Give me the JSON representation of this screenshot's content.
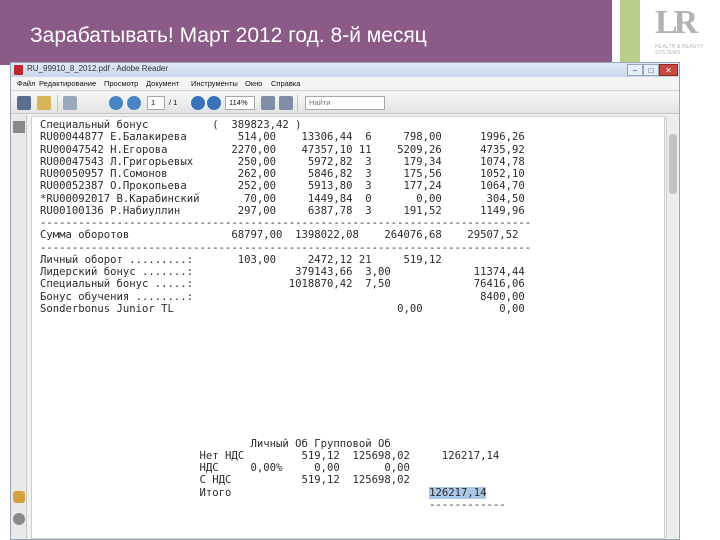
{
  "slide": {
    "title": "Зарабатывать! Март 2012 год.  8-й месяц"
  },
  "logo": {
    "mark": "LR",
    "tagline": "HEALTH & BEAUTY SYSTEMS"
  },
  "window": {
    "title": "RU_99910_8_2012.pdf - Adobe Reader",
    "min": "–",
    "max": "□",
    "close": "✕"
  },
  "menu": [
    "Файл",
    "Редактирование",
    "Просмотр",
    "Документ",
    "Инструменты",
    "Окно",
    "Справка"
  ],
  "toolbar": {
    "page_current": "1",
    "page_total": "/ 1",
    "zoom": "114%",
    "find_placeholder": "Найти"
  },
  "icons": {
    "print": "printer-icon",
    "email": "email-icon",
    "hand": "hand-tool-icon",
    "prev": "arrow-up-icon",
    "next": "arrow-down-icon",
    "zoom_out": "zoom-out-icon",
    "zoom_in": "zoom-in-icon",
    "pages": "pages-panel-icon",
    "comment": "comment-icon",
    "attach": "paperclip-icon"
  },
  "document": {
    "lines": [
      "Специальный бонус          (  389823,42 )",
      "RU00044877 Е.Балакирева        514,00    13306,44  6     798,00      1996,26",
      "RU00047542 Н.Егорова          2270,00    47357,10 11    5209,26      4735,92",
      "RU00047543 Л.Григорьевых       250,00     5972,82  3     179,34      1074,78",
      "RU00050957 П.Сомонов           262,00     5846,82  3     175,56      1052,10",
      "RU00052387 О.Прокопьева        252,00     5913,80  3     177,24      1064,70",
      "*RU00092017 В.Карабинский       70,00     1449,84  0       0,00       304,50",
      "RU00100136 Р.Набиуллин         297,00     6387,78  3     191,52      1149,96",
      "-----------------------------------------------------------------------------",
      "Сумма оборотов                68797,00  1398022,08    264076,68    29507,52",
      "-----------------------------------------------------------------------------",
      "Личный оборот .........:       103,00     2472,12 21     519,12",
      "Лидерский бонус .......:                379143,66  3,00             11374,44",
      "Специальный бонус .....:               1018870,42  7,50             76416,06",
      "Бонус обучения ........:                                             8400,00",
      "Sonderbonus Junior TL                                   0,00            0,00",
      "",
      "",
      "",
      "",
      "",
      "",
      "",
      "",
      "",
      "",
      "                                 Личный Об Групповой Об",
      "                         Нет НДС         519,12  125698,02     126217,14",
      "                         НДС     0,00%     0,00       0,00",
      "                         С НДС           519,12  125698,02",
      "                         Итого                               ",
      "                                                             ------------"
    ],
    "total_highlight": "126217,14"
  }
}
